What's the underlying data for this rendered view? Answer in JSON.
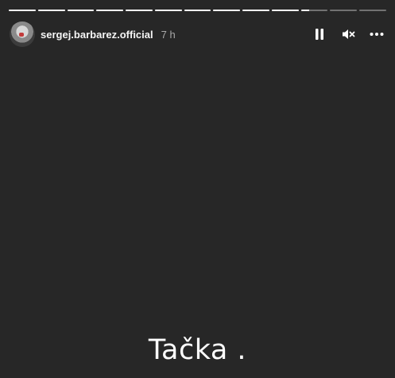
{
  "progress": {
    "segments": 13,
    "viewed": 10,
    "current_fraction": 0.3
  },
  "header": {
    "username": "sergej.barbarez.official",
    "time": "7 h"
  },
  "controls": {
    "pause_icon": "pause-icon",
    "mute_icon": "muted-speaker-icon",
    "more_icon": "more-horizontal-icon"
  },
  "caption": "Tačka .",
  "colors": {
    "background": "#272727",
    "progress_fill": "#ffffff",
    "progress_track": "rgba(255,255,255,0.35)"
  }
}
